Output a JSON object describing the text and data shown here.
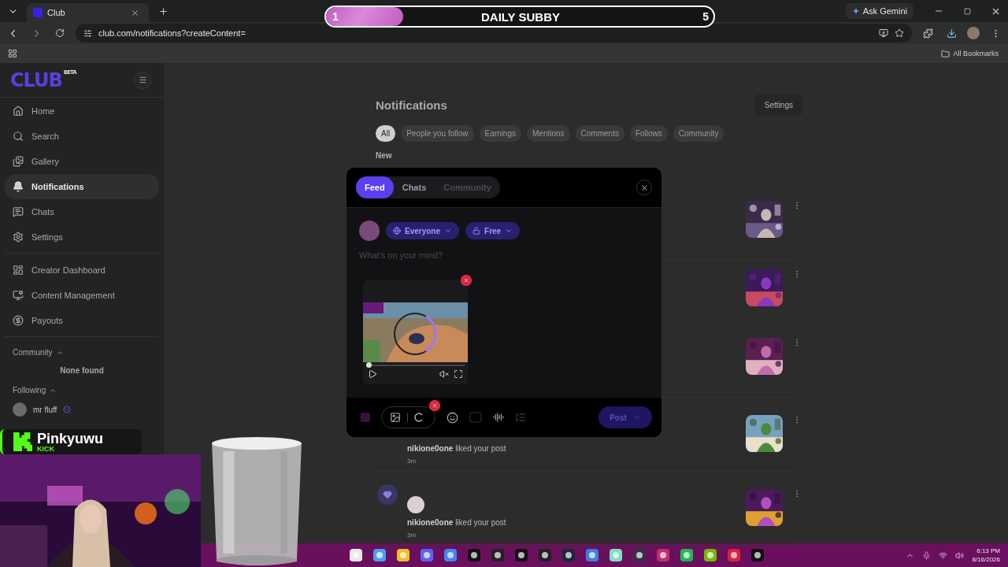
{
  "browser": {
    "tab": {
      "title": "Club"
    },
    "url": "club.com/notifications?createContent=",
    "assistant_button": "Ask Gemini",
    "bookmarks_folder": "All Bookmarks"
  },
  "stream_overlay": {
    "goal_bar": {
      "start": "1",
      "title": "DAILY SUBBY",
      "end": "5",
      "level": 0.2
    },
    "kick_badge": {
      "name": "Pinkyuwu",
      "platform": "KICK"
    },
    "webcam": {
      "kind": "picture"
    },
    "glass": {
      "kind": "picture"
    }
  },
  "sidebar": {
    "logo": "CLUB",
    "logo_badge": "BETA",
    "nav_groups": [
      [
        {
          "label": "Home",
          "selected": false
        },
        {
          "label": "Search",
          "selected": false
        },
        {
          "label": "Gallery",
          "selected": false
        },
        {
          "label": "Notifications",
          "selected": true
        },
        {
          "label": "Chats",
          "selected": false
        },
        {
          "label": "Settings",
          "selected": false
        }
      ],
      [
        {
          "label": "Creator Dashboard",
          "selected": false
        },
        {
          "label": "Content Management",
          "selected": false
        },
        {
          "label": "Payouts",
          "selected": false
        }
      ]
    ],
    "community": {
      "title": "Community",
      "expanded": true,
      "empty_text": "None found"
    },
    "following": {
      "title": "Following",
      "expanded": true,
      "people": [
        {
          "name": "mr fluff"
        }
      ]
    }
  },
  "main": {
    "title": "Notifications",
    "settings_button": "Settings",
    "filters": [
      {
        "label": "All",
        "selected": true
      },
      {
        "label": "People you follow",
        "selected": false
      },
      {
        "label": "Earnings",
        "selected": false
      },
      {
        "label": "Mentions",
        "selected": false
      },
      {
        "label": "Comments",
        "selected": false
      },
      {
        "label": "Follows",
        "selected": false
      },
      {
        "label": "Community",
        "selected": false
      }
    ],
    "section": "New",
    "notifications": [
      {
        "thumbnail": {
          "kind": "picture"
        }
      },
      {
        "thumbnail": {
          "kind": "picture"
        }
      },
      {
        "thumbnail": {
          "kind": "picture"
        }
      },
      {
        "text": "**nikione0one** liked your post",
        "time": "3m",
        "thumbnail": {
          "kind": "picture"
        }
      },
      {
        "kind": "like",
        "text": "**nikione0one** liked your post",
        "time": "3m",
        "thumbnail": {
          "kind": "picture"
        }
      }
    ]
  },
  "composer": {
    "tabs": [
      {
        "label": "Feed",
        "selected": true,
        "disabled": false
      },
      {
        "label": "Chats",
        "selected": false,
        "disabled": false
      },
      {
        "label": "Community",
        "selected": false,
        "disabled": true
      }
    ],
    "audience": "Everyone",
    "price": "Free",
    "placeholder": "What's on your mind?",
    "attachment": {
      "kind": "picture",
      "progress": {
        "level": 0.02
      }
    },
    "post_button": {
      "label": "Post",
      "disabled": true
    }
  },
  "taskbar": {
    "time": "6:13 PM",
    "date": "8/16/2026"
  }
}
